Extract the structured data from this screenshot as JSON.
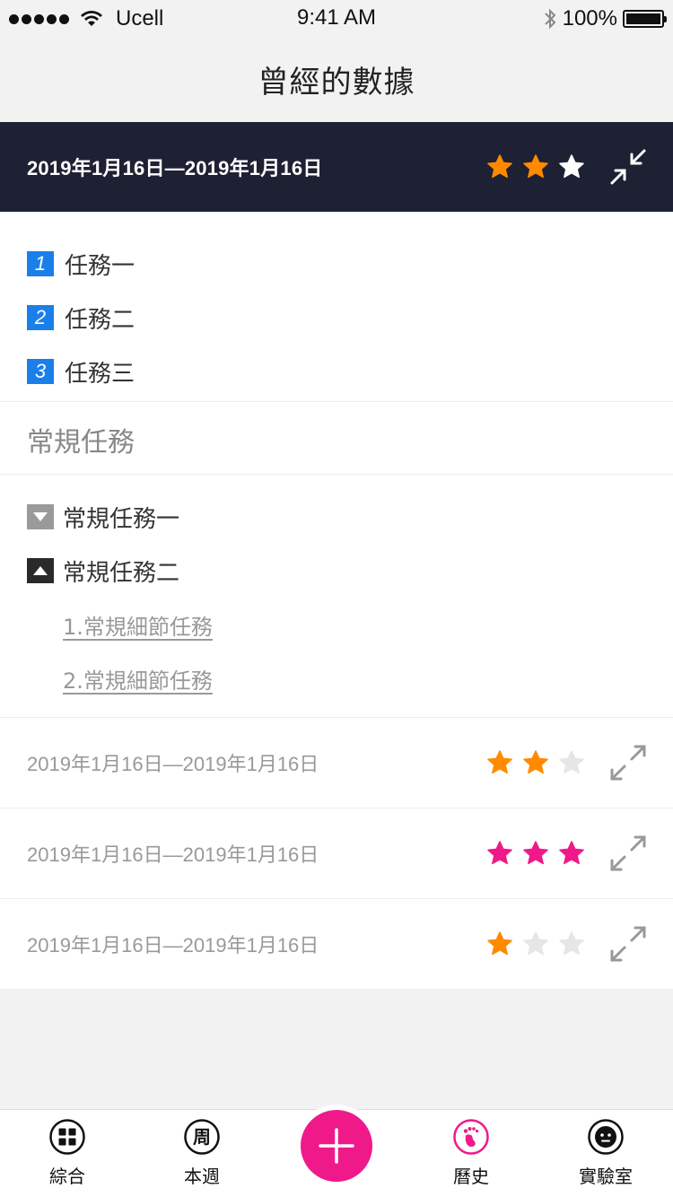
{
  "status_bar": {
    "carrier": "Ucell",
    "time": "9:41 AM",
    "battery": "100%",
    "signal_dots": 5
  },
  "nav": {
    "title": "曾經的數據"
  },
  "colors": {
    "header_bg": "#1e2133",
    "accent_blue": "#1a7fe8",
    "star_orange": "#ff8a00",
    "star_pink": "#f0198a",
    "star_white": "#ffffff",
    "star_empty": "#e6e6e6",
    "fab": "#f0198a"
  },
  "active_record": {
    "date_range": "2019年1月16日—2019年1月16日",
    "rating": 2,
    "max_rating": 3,
    "tasks": [
      {
        "number": "1",
        "label": "任務一"
      },
      {
        "number": "2",
        "label": "任務二"
      },
      {
        "number": "3",
        "label": "任務三"
      }
    ],
    "routine_section_title": "常規任務",
    "routines": [
      {
        "label": "常規任務一",
        "expanded": false
      },
      {
        "label": "常規任務二",
        "expanded": true
      }
    ],
    "routine_details": [
      {
        "label": "1.常規細節任務"
      },
      {
        "label": "2.常規細節任務"
      }
    ]
  },
  "history": [
    {
      "date_range": "2019年1月16日—2019年1月16日",
      "rating": 2,
      "star_color": "orange"
    },
    {
      "date_range": "2019年1月16日—2019年1月16日",
      "rating": 3,
      "star_color": "pink"
    },
    {
      "date_range": "2019年1月16日—2019年1月16日",
      "rating": 1,
      "star_color": "orange"
    }
  ],
  "tabs": [
    {
      "label": "綜合",
      "icon": "grid-icon"
    },
    {
      "label": "本週",
      "icon": "week-icon",
      "glyph": "周"
    },
    {
      "label": "",
      "icon": "add-icon"
    },
    {
      "label": "曆史",
      "icon": "footprint-icon"
    },
    {
      "label": "實驗室",
      "icon": "face-icon"
    }
  ]
}
